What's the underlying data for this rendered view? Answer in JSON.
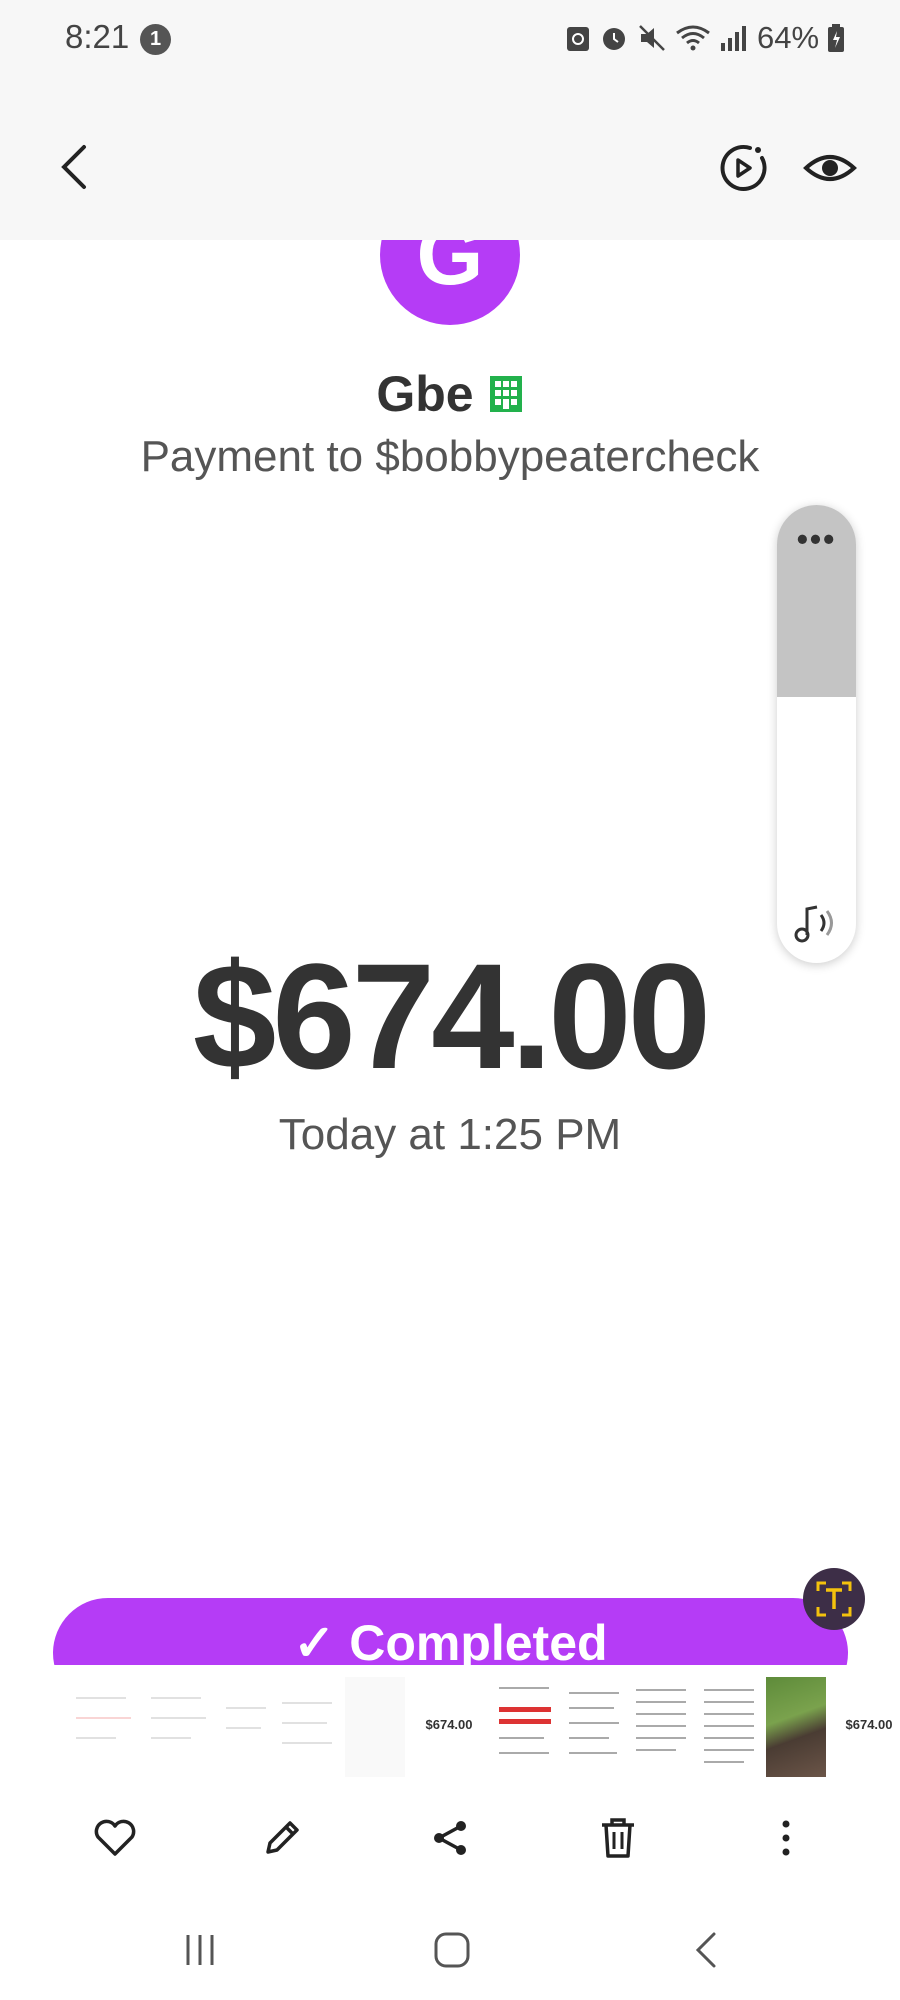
{
  "status_bar": {
    "time": "8:21",
    "notification_count": "1",
    "battery": "64%"
  },
  "header": {
    "back_icon": "chevron-left-icon",
    "motion_icon": "motion-photo-icon",
    "eye_icon": "eye-icon"
  },
  "recipient": {
    "avatar_letter": "G",
    "name": "Gbe",
    "business_icon": "building-icon",
    "payment_to": "Payment to $bobbypeatercheck"
  },
  "volume_panel": {
    "more": "•••",
    "level": 0.42,
    "icon": "music-note-icon"
  },
  "payment": {
    "amount": "$674.00",
    "date": "Today at 1:25 PM",
    "status": "✓ Completed"
  },
  "colors": {
    "accent": "#b53cf6",
    "business_green": "#22b14c"
  },
  "thumbnails": {
    "amount_label_1": "$674.00",
    "amount_label_2": "$674.00"
  },
  "actions": [
    {
      "name": "favorite",
      "icon": "heart-icon"
    },
    {
      "name": "edit",
      "icon": "pencil-icon"
    },
    {
      "name": "share",
      "icon": "share-icon"
    },
    {
      "name": "delete",
      "icon": "trash-icon"
    },
    {
      "name": "more",
      "icon": "more-vertical-icon"
    }
  ],
  "nav": {
    "recents": "recents-icon",
    "home": "home-icon",
    "back": "back-icon"
  }
}
